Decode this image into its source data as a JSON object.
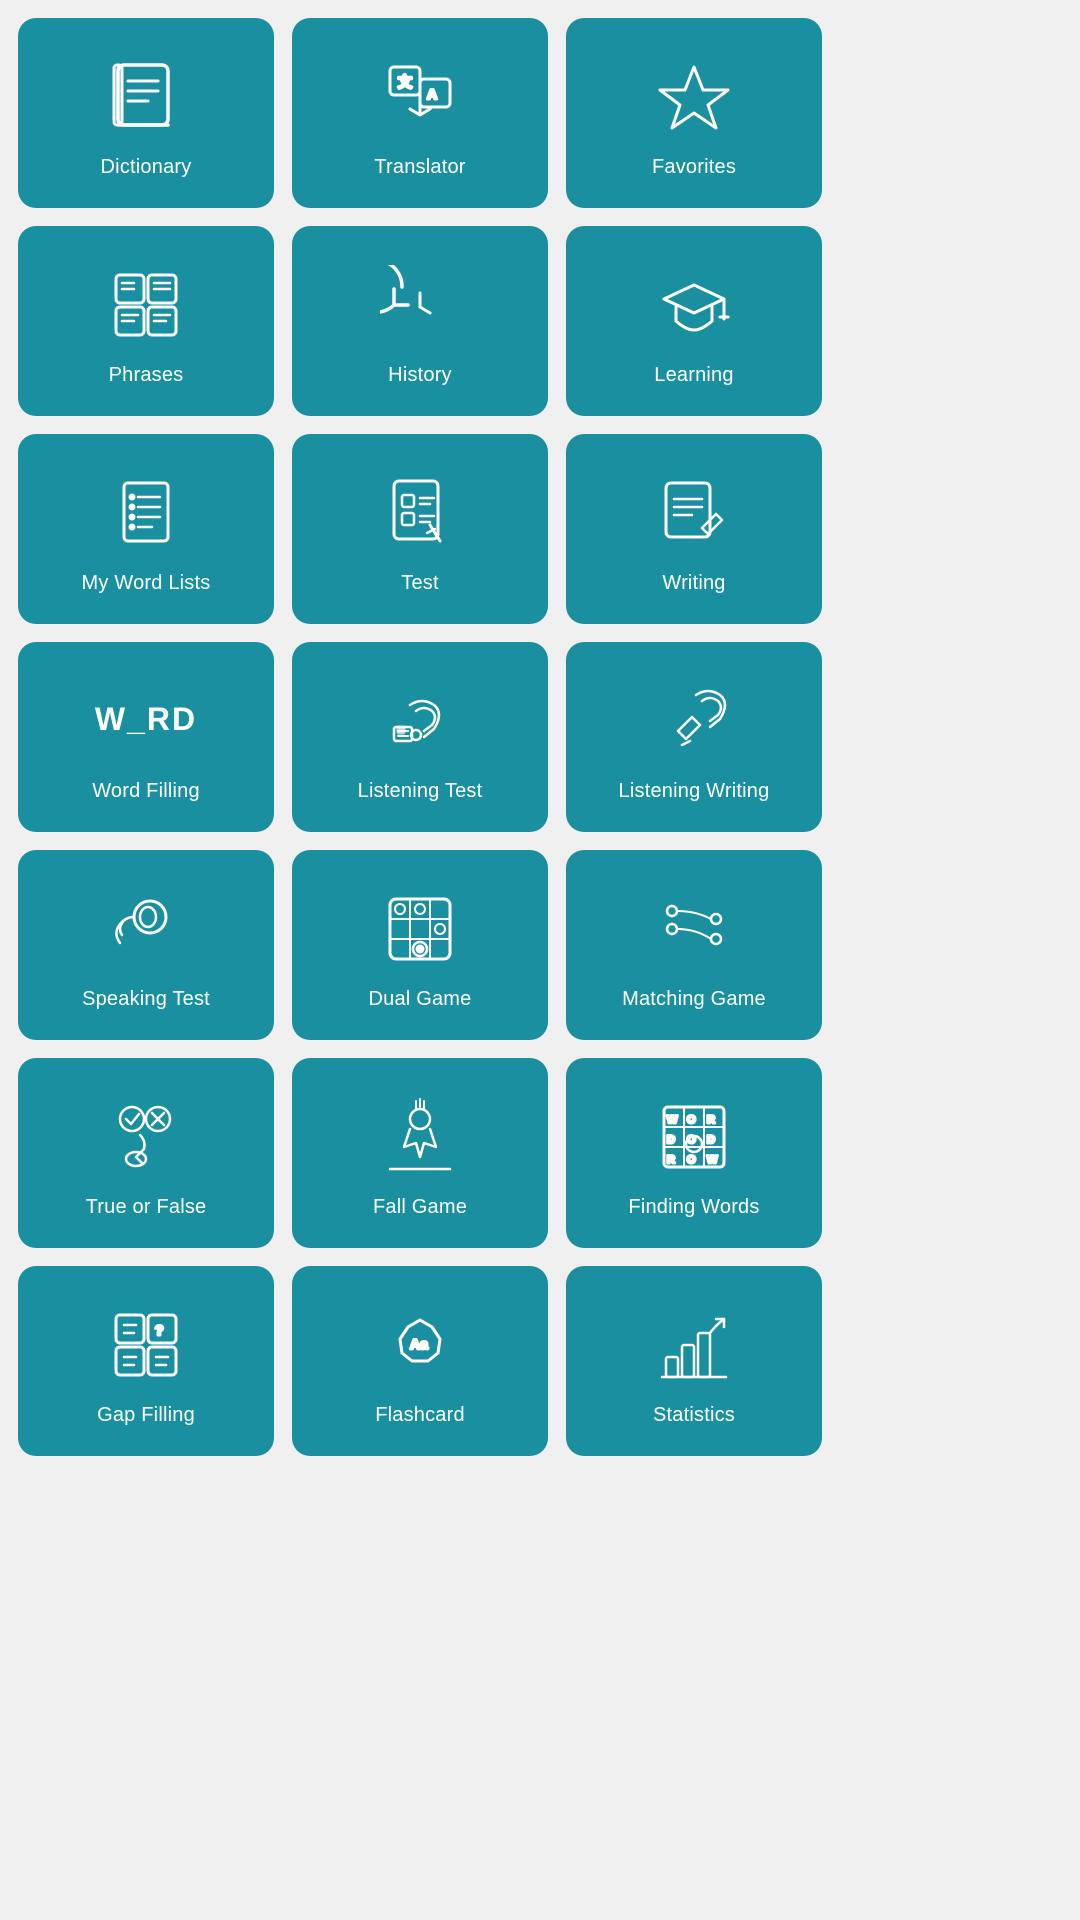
{
  "tiles": [
    {
      "id": "dictionary",
      "label": "Dictionary"
    },
    {
      "id": "translator",
      "label": "Translator"
    },
    {
      "id": "favorites",
      "label": "Favorites"
    },
    {
      "id": "phrases",
      "label": "Phrases"
    },
    {
      "id": "history",
      "label": "History"
    },
    {
      "id": "learning",
      "label": "Learning"
    },
    {
      "id": "my-word-lists",
      "label": "My Word Lists"
    },
    {
      "id": "test",
      "label": "Test"
    },
    {
      "id": "writing",
      "label": "Writing"
    },
    {
      "id": "word-filling",
      "label": "Word Filling"
    },
    {
      "id": "listening-test",
      "label": "Listening Test"
    },
    {
      "id": "listening-writing",
      "label": "Listening Writing"
    },
    {
      "id": "speaking-test",
      "label": "Speaking Test"
    },
    {
      "id": "dual-game",
      "label": "Dual Game"
    },
    {
      "id": "matching-game",
      "label": "Matching Game"
    },
    {
      "id": "true-or-false",
      "label": "True or False"
    },
    {
      "id": "fall-game",
      "label": "Fall Game"
    },
    {
      "id": "finding-words",
      "label": "Finding Words"
    },
    {
      "id": "gap-filling",
      "label": "Gap Filling"
    },
    {
      "id": "flashcard",
      "label": "Flashcard"
    },
    {
      "id": "statistics",
      "label": "Statistics"
    }
  ]
}
